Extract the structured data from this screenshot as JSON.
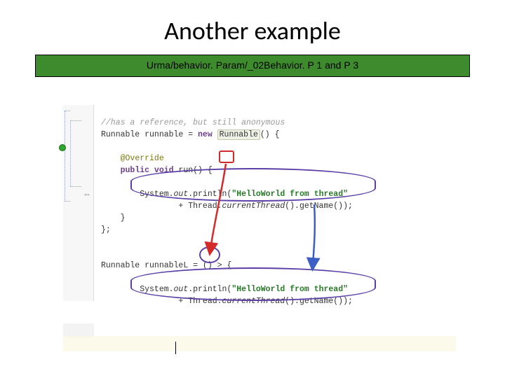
{
  "title": "Another example",
  "banner": "Urma/behavior. Param/_02Behavior. P 1 and P 3",
  "gutter": {
    "collapse_glyph": "⇔"
  },
  "code": {
    "l1_comment": "//has a reference, but still anonymous",
    "l2_a": "Runnable runnable = ",
    "l2_new": "new",
    "l2_b": " ",
    "l2_type": "Runnable",
    "l2_c": "() {",
    "l3": "",
    "l4_ann": "@Override",
    "l5_a": "public void",
    "l5_b": " run",
    "l5_c": "()",
    "l5_d": " {",
    "l6": "",
    "l7_a": "        System.",
    "l7_out": "out",
    "l7_b": ".println(",
    "l7_str": "\"HelloWorld from thread\"",
    "l8_a": "                + Thread.",
    "l8_m": "currentThread",
    "l8_b": "().getName());",
    "l9": "    }",
    "l10": "};",
    "l11": "",
    "l12": "",
    "l13_a": "Runnable runnableL = ",
    "l13_lp": "()",
    "l13_arrow": " > ",
    "l13_b": "{",
    "l14": "",
    "l15_a": "        System.",
    "l15_out": "out",
    "l15_b": ".println(",
    "l15_str": "\"HelloWorld from thread\"",
    "l16_a": "                + Thread.",
    "l16_m": "currentThread",
    "l16_b": "().getName());"
  },
  "annotations": {
    "red_box_target": "run() parens",
    "purple_circle_target": "lambda () parens",
    "purple_oval1": "println body block (anonymous class)",
    "purple_oval2": "println body block (lambda)",
    "arrow_red": "red-to-lambda",
    "arrow_blue": "downward"
  }
}
